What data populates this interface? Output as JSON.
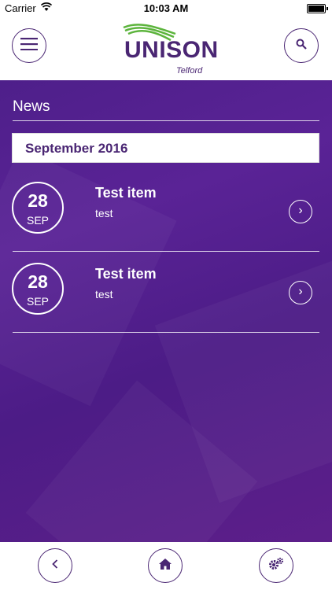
{
  "status_bar": {
    "carrier": "Carrier",
    "time": "10:03 AM"
  },
  "header": {
    "logo_text": "UNISON",
    "logo_subtitle": "Telford",
    "menu_icon": "hamburger-menu-icon",
    "search_icon": "search-icon"
  },
  "section": {
    "title": "News",
    "month_label": "September 2016"
  },
  "items": [
    {
      "day": "28",
      "month": "SEP",
      "title": "Test item",
      "subtitle": "test"
    },
    {
      "day": "28",
      "month": "SEP",
      "title": "Test item",
      "subtitle": "test"
    }
  ],
  "footer": {
    "back_icon": "chevron-left-icon",
    "home_icon": "home-icon",
    "settings_icon": "gears-icon"
  },
  "colors": {
    "brand_purple": "#4a2673",
    "background_purple": "#541f8f",
    "logo_green": "#5cb43c"
  }
}
